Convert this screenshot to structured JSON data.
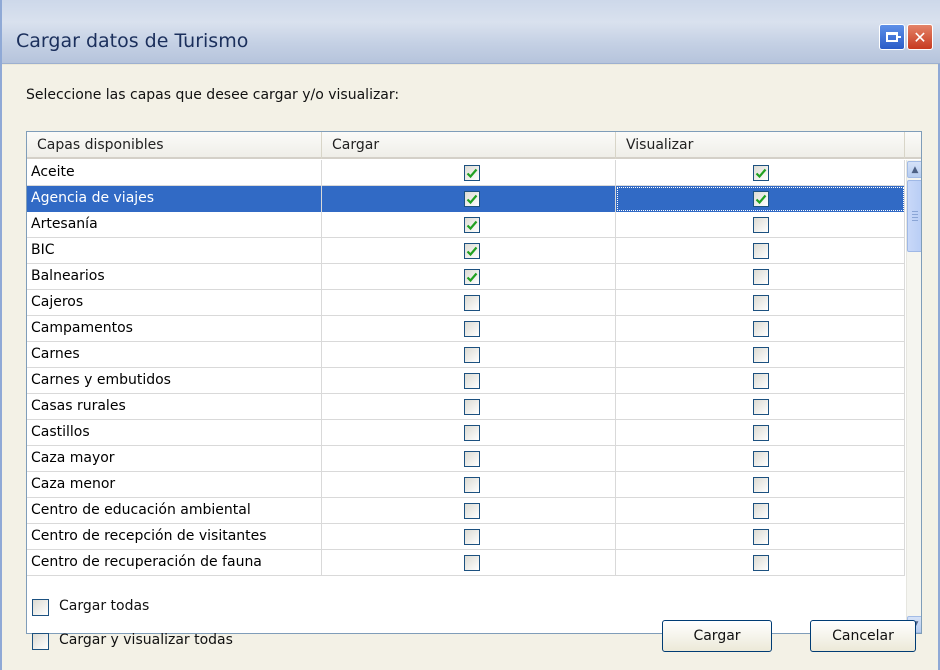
{
  "window": {
    "title": "Cargar datos de Turismo"
  },
  "prompt": "Seleccione las capas que desee cargar y/o visualizar:",
  "columns": [
    "Capas disponibles",
    "Cargar",
    "Visualizar"
  ],
  "rows": [
    {
      "name": "Aceite",
      "load": true,
      "view": true
    },
    {
      "name": "Agencia de viajes",
      "load": true,
      "view": true,
      "selected": true
    },
    {
      "name": "Artesanía",
      "load": true,
      "view": false
    },
    {
      "name": "BIC",
      "load": true,
      "view": false
    },
    {
      "name": "Balnearios",
      "load": true,
      "view": false
    },
    {
      "name": "Cajeros",
      "load": false,
      "view": false
    },
    {
      "name": "Campamentos",
      "load": false,
      "view": false
    },
    {
      "name": "Carnes",
      "load": false,
      "view": false
    },
    {
      "name": "Carnes y embutidos",
      "load": false,
      "view": false
    },
    {
      "name": "Casas rurales",
      "load": false,
      "view": false
    },
    {
      "name": "Castillos",
      "load": false,
      "view": false
    },
    {
      "name": "Caza mayor",
      "load": false,
      "view": false
    },
    {
      "name": "Caza menor",
      "load": false,
      "view": false
    },
    {
      "name": "Centro de educación ambiental",
      "load": false,
      "view": false
    },
    {
      "name": "Centro de recepción de visitantes",
      "load": false,
      "view": false
    },
    {
      "name": "Centro de recuperación de fauna",
      "load": false,
      "view": false
    }
  ],
  "options": {
    "load_all": {
      "label": "Cargar todas",
      "checked": false
    },
    "load_view_all": {
      "label": "Cargar y visualizar todas",
      "checked": false
    }
  },
  "buttons": {
    "load": "Cargar",
    "cancel": "Cancelar"
  },
  "colors": {
    "selection": "#316ac5",
    "checkmark": "#21a121",
    "title_text": "#1b2f5c"
  }
}
